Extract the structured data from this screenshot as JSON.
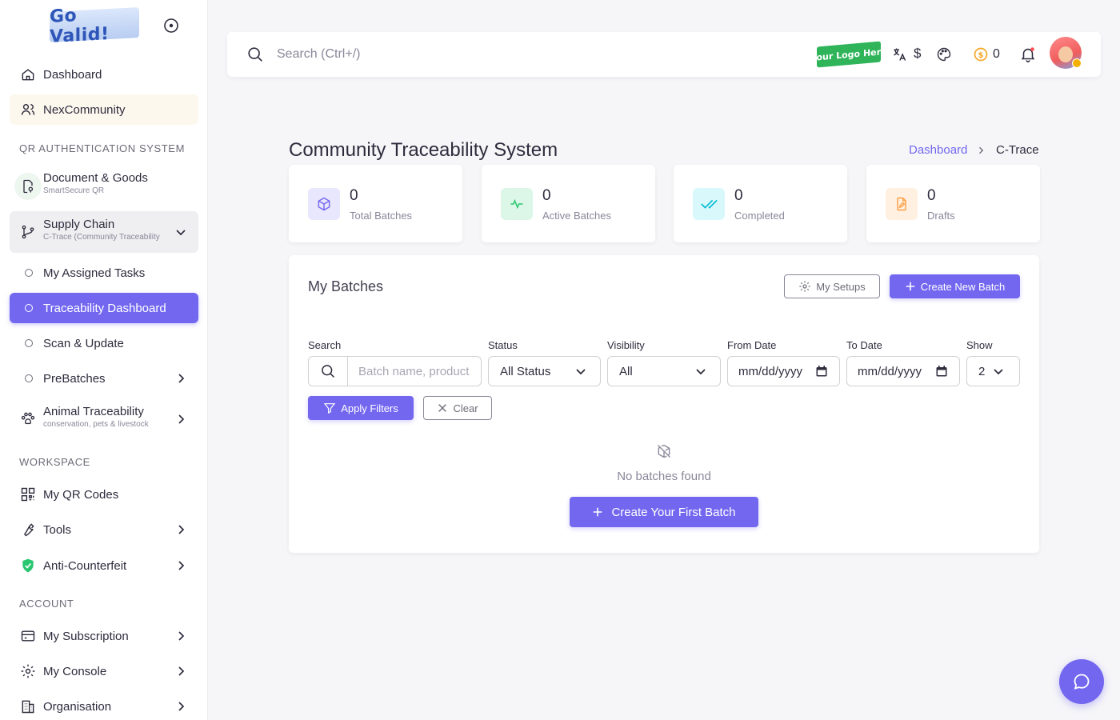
{
  "sidebar": {
    "brand": "Go Valid!",
    "items": [
      {
        "label": "Dashboard"
      },
      {
        "label": "NexCommunity"
      },
      {
        "label": "Document & Goods",
        "sub": "SmartSecure QR"
      },
      {
        "label": "Supply Chain",
        "sub": "C-Trace (Community Traceability"
      },
      {
        "label": "My Assigned Tasks"
      },
      {
        "label": "Traceability Dashboard"
      },
      {
        "label": "Scan & Update"
      },
      {
        "label": "PreBatches"
      },
      {
        "label": "Animal Traceability",
        "sub": "conservation, pets & livestock"
      },
      {
        "label": "My QR Codes"
      },
      {
        "label": "Tools"
      },
      {
        "label": "Anti-Counterfeit"
      },
      {
        "label": "My Subscription"
      },
      {
        "label": "My Console"
      },
      {
        "label": "Organisation"
      }
    ],
    "sections": {
      "qr": "QR AUTHENTICATION SYSTEM",
      "workspace": "WORKSPACE",
      "account": "ACCOUNT"
    }
  },
  "topbar": {
    "search_placeholder": "Search (Ctrl+/)",
    "logo_text": "Your Logo Here",
    "currency": "$",
    "coin_count": "0"
  },
  "header": {
    "title": "Community Traceability System",
    "breadcrumb_link": "Dashboard",
    "breadcrumb_current": "C-Trace"
  },
  "stats": [
    {
      "value": "0",
      "label": "Total Batches"
    },
    {
      "value": "0",
      "label": "Active Batches"
    },
    {
      "value": "0",
      "label": "Completed"
    },
    {
      "value": "0",
      "label": "Drafts"
    }
  ],
  "batches": {
    "title": "My Batches",
    "my_setups": "My Setups",
    "create_new": "Create New Batch",
    "filters": {
      "search_label": "Search",
      "search_placeholder": "Batch name, product...",
      "status_label": "Status",
      "status_value": "All Status",
      "visibility_label": "Visibility",
      "visibility_value": "All",
      "from_label": "From Date",
      "from_value": "mm/dd/yyyy",
      "to_label": "To Date",
      "to_value": "mm/dd/yyyy",
      "show_label": "Show",
      "show_value": "2"
    },
    "apply": "Apply Filters",
    "clear": "Clear",
    "empty": "No batches found",
    "create_first": "Create Your First Batch"
  },
  "colors": {
    "primary": "#7367f0",
    "text": "#2f2b3d",
    "muted": "#8a8799"
  }
}
